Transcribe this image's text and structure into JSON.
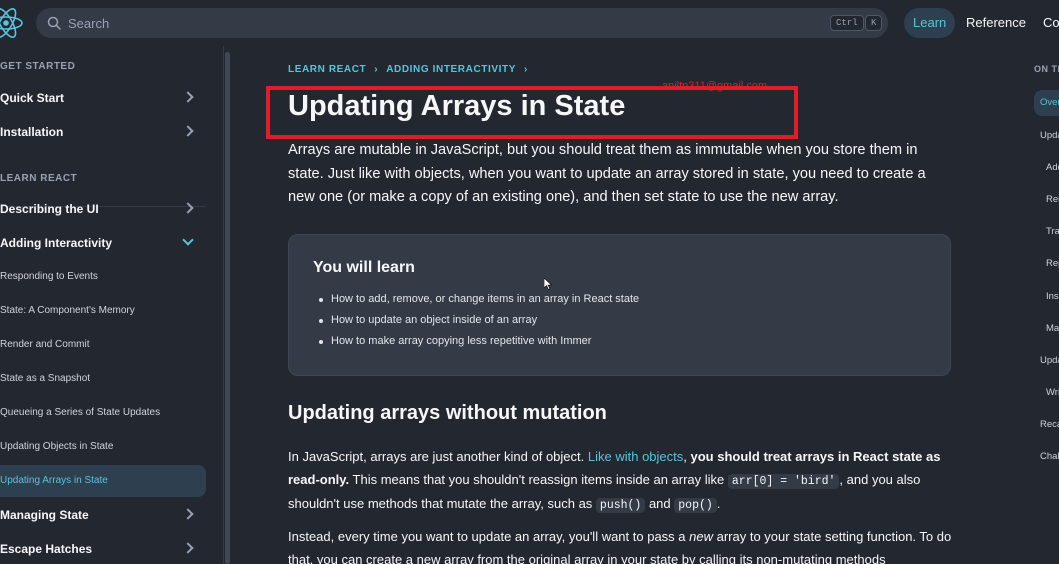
{
  "topbar": {
    "search_placeholder": "Search",
    "kbd_ctrl": "Ctrl",
    "kbd_k": "K",
    "nav": {
      "learn": "Learn",
      "reference": "Reference",
      "community": "Co"
    }
  },
  "sidebar": {
    "section_get_started": "GET STARTED",
    "quick_start": "Quick Start",
    "installation": "Installation",
    "section_learn": "LEARN REACT",
    "describing_ui": "Describing the UI",
    "adding_interactivity": "Adding Interactivity",
    "sub_items": [
      "Responding to Events",
      "State: A Component's Memory",
      "Render and Commit",
      "State as a Snapshot",
      "Queueing a Series of State Updates",
      "Updating Objects in State",
      "Updating Arrays in State"
    ],
    "managing_state": "Managing State",
    "escape_hatches": "Escape Hatches"
  },
  "main": {
    "breadcrumb": [
      "LEARN REACT",
      "ADDING INTERACTIVITY"
    ],
    "watermark": "aniltn311@gmail.com",
    "title": "Updating Arrays in State",
    "intro": "Arrays are mutable in JavaScript, but you should treat them as immutable when you store them in state. Just like with objects, when you want to update an array stored in state, you need to create a new one (or make a copy of an existing one), and then set state to use the new array.",
    "learn_box": {
      "title": "You will learn",
      "items": [
        "How to add, remove, or change items in an array in React state",
        "How to update an object inside of an array",
        "How to make array copying less repetitive with Immer"
      ]
    },
    "section_heading": "Updating arrays without mutation",
    "p1": {
      "t1": "In JavaScript, arrays are just another kind of object. ",
      "link": "Like with objects",
      "t2": ", ",
      "bold": "you should treat arrays in React state as read-only.",
      "t3": " This means that you shouldn't reassign items inside an array like ",
      "code1": "arr[0] = 'bird'",
      "t4": ", and you also shouldn't use methods that mutate the array, such as ",
      "code2": "push()",
      "t5": " and ",
      "code3": "pop()",
      "t6": "."
    },
    "p2": {
      "t1": "Instead, every time you want to update an array, you'll want to pass a ",
      "em": "new",
      "t2": " array to your state setting function. To do that, you can create a new array from the original array in your state by calling its non-mutating methods"
    }
  },
  "toc": {
    "heading": "ON THIS PAGE",
    "items": [
      "Overview",
      "Updating arrays without mutation",
      "Adding to an array",
      "Removing from an array",
      "Transforming an array",
      "Replacing items in an array",
      "Inserting into an array",
      "Making other changes to an array",
      "Updating objects inside arrays",
      "Write concise update logic with Immer",
      "Recap",
      "Challenges"
    ]
  },
  "colors": {
    "background": "#23272f",
    "accent": "#58c4dc",
    "panel": "#343a46",
    "annotation_red": "#e01e2b"
  }
}
